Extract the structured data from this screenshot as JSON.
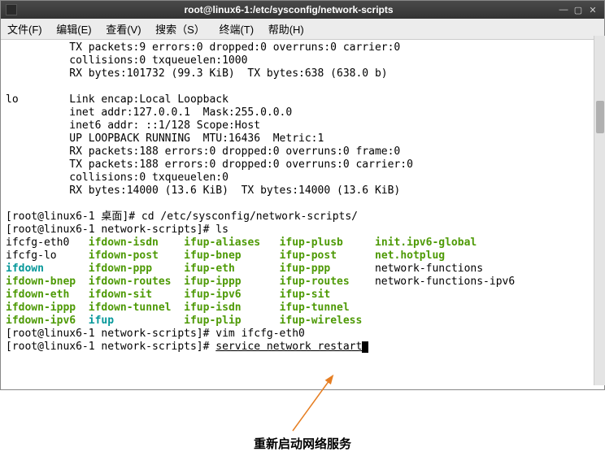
{
  "window": {
    "title": "root@linux6-1:/etc/sysconfig/network-scripts"
  },
  "menubar": {
    "file": "文件(F)",
    "edit": "编辑(E)",
    "view": "查看(V)",
    "search": "搜索（S）",
    "terminal": "终端(T)",
    "help": "帮助(H)"
  },
  "term": {
    "l01": "          TX packets:9 errors:0 dropped:0 overruns:0 carrier:0",
    "l02": "          collisions:0 txqueuelen:1000",
    "l03": "          RX bytes:101732 (99.3 KiB)  TX bytes:638 (638.0 b)",
    "l04": "",
    "l05": "lo        Link encap:Local Loopback",
    "l06": "          inet addr:127.0.0.1  Mask:255.0.0.0",
    "l07": "          inet6 addr: ::1/128 Scope:Host",
    "l08": "          UP LOOPBACK RUNNING  MTU:16436  Metric:1",
    "l09": "          RX packets:188 errors:0 dropped:0 overruns:0 frame:0",
    "l10": "          TX packets:188 errors:0 dropped:0 overruns:0 carrier:0",
    "l11": "          collisions:0 txqueuelen:0",
    "l12": "          RX bytes:14000 (13.6 KiB)  TX bytes:14000 (13.6 KiB)",
    "l13": "",
    "p1": "[root@linux6-1 桌面]# ",
    "c1": "cd /etc/sysconfig/network-scripts/",
    "p2": "[root@linux6-1 network-scripts]# ",
    "c2": "ls",
    "ls": {
      "r1c1": "ifcfg-eth0",
      "r1c2": "ifdown-isdn",
      "r1c3": "ifup-aliases",
      "r1c4": "ifup-plusb",
      "r1c5": "init.ipv6-global",
      "r2c1": "ifcfg-lo",
      "r2c2": "ifdown-post",
      "r2c3": "ifup-bnep",
      "r2c4": "ifup-post",
      "r2c5": "net.hotplug",
      "r3c1": "ifdown",
      "r3c2": "ifdown-ppp",
      "r3c3": "ifup-eth",
      "r3c4": "ifup-ppp",
      "r3c5": "network-functions",
      "r4c1": "ifdown-bnep",
      "r4c2": "ifdown-routes",
      "r4c3": "ifup-ippp",
      "r4c4": "ifup-routes",
      "r4c5": "network-functions-ipv6",
      "r5c1": "ifdown-eth",
      "r5c2": "ifdown-sit",
      "r5c3": "ifup-ipv6",
      "r5c4": "ifup-sit",
      "r6c1": "ifdown-ippp",
      "r6c2": "ifdown-tunnel",
      "r6c3": "ifup-isdn",
      "r6c4": "ifup-tunnel",
      "r7c1": "ifdown-ipv6",
      "r7c2": "ifup",
      "r7c3": "ifup-plip",
      "r7c4": "ifup-wireless"
    },
    "p3": "[root@linux6-1 network-scripts]# ",
    "c3": "vim ifcfg-eth0",
    "p4": "[root@linux6-1 network-scripts]# ",
    "c4": "service network restart"
  },
  "annotation": {
    "caption": "重新启动网络服务"
  }
}
